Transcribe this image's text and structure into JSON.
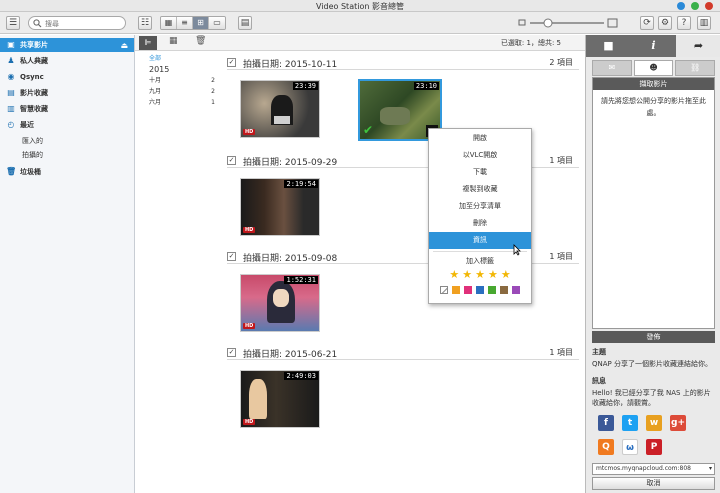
{
  "window": {
    "title": "Video Station 影音總管"
  },
  "toolbar": {
    "search_placeholder": "搜尋"
  },
  "sidebar": {
    "items": [
      {
        "label": "共享影片"
      },
      {
        "label": "私人典藏"
      },
      {
        "label": "Qsync"
      },
      {
        "label": "影片收藏"
      },
      {
        "label": "智慧收藏"
      },
      {
        "label": "最近"
      },
      {
        "label": "匯入的"
      },
      {
        "label": "拍攝的"
      },
      {
        "label": "垃圾桶"
      }
    ]
  },
  "main": {
    "count_text": "已選取: 1，總共: 5",
    "timeline": {
      "all": "全部",
      "year": "2015",
      "months": [
        {
          "label": "十月",
          "count": "2"
        },
        {
          "label": "九月",
          "count": "2"
        },
        {
          "label": "六月",
          "count": "1"
        }
      ]
    },
    "groups": [
      {
        "date": "拍攝日期: 2015-10-11",
        "count": "2 項目"
      },
      {
        "date": "拍攝日期: 2015-09-29",
        "count": "1 項目"
      },
      {
        "date": "拍攝日期: 2015-09-08",
        "count": "1 項目"
      },
      {
        "date": "拍攝日期: 2015-06-21",
        "count": "1 項目"
      }
    ],
    "videos": [
      {
        "duration": "23:39",
        "badge": "HD"
      },
      {
        "duration": "23:10",
        "badge": "HD"
      },
      {
        "duration": "2:19:54",
        "badge": "HD"
      },
      {
        "duration": "1:52:31",
        "badge": "HD"
      },
      {
        "duration": "2:49:03",
        "badge": "HD"
      }
    ]
  },
  "context_menu": {
    "items": [
      "開啟",
      "以VLC開啟",
      "下載",
      "複製到收藏",
      "加至分享清單",
      "刪除",
      "資訊"
    ],
    "tag_label": "加入標籤",
    "star_glyph": "★",
    "stars": 5,
    "star_color": "#f2b705",
    "tag_colors": [
      "#f0a020",
      "#e0307a",
      "#2a6fc0",
      "#48a830",
      "#8a6a40",
      "#9a4ab8"
    ]
  },
  "right_panel": {
    "box_header": "擷取影片",
    "box_hint": "請先將您想公開分享的影片拖至此處。",
    "post_button": "發佈",
    "subject_label": "主題",
    "subject_text": "QNAP 分享了一個影片收藏連結給你。",
    "message_label": "訊息",
    "message_text": "Hello! 我已經分享了我 NAS 上的影片收藏給你，請觀賞。",
    "url": "mtcmos.myqnapcloud.com:808",
    "cancel": "取消"
  }
}
